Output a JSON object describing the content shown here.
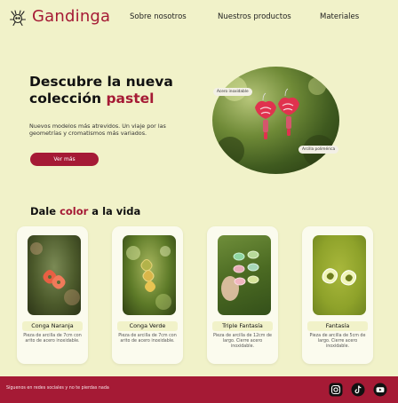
{
  "brand": {
    "name": "Gandinga",
    "accent": "#a51a35",
    "background": "#f1f2c9"
  },
  "nav": {
    "items": [
      "Sobre nosotros",
      "Nuestros productos",
      "Materiales"
    ]
  },
  "hero": {
    "title_pre": "Descubre la nueva colección ",
    "title_accent": "pastel",
    "description": "Nuevos modelos más atrevidos. Un viaje por las geometrías y cromatismos más variados.",
    "button_label": "Ver más",
    "tag_1": "Acero inoxidable",
    "tag_2": "Arcilla polimérica"
  },
  "section": {
    "title_pre": "Dale ",
    "title_accent": "color",
    "title_post": " a la vida"
  },
  "products": [
    {
      "name": "Conga Naranja",
      "description": "Pieza de arcilla de 7cm con arito de acero inoxidable."
    },
    {
      "name": "Conga Verde",
      "description": "Pieza de arcilla de 7cm con arito de acero inoxidable."
    },
    {
      "name": "Triple Fantasía",
      "description": "Pieza de arcilla de 12cm de largo. Cierre acero inoxidable."
    },
    {
      "name": "Fantasía",
      "description": "Pieza de arcilla de 5cm de largo. Cierre acero inoxidable."
    }
  ],
  "footer": {
    "text": "Síguenos en redes sociales y no te pierdas nada"
  },
  "icons": [
    "logo-icon",
    "instagram-icon",
    "tiktok-icon",
    "youtube-icon"
  ]
}
